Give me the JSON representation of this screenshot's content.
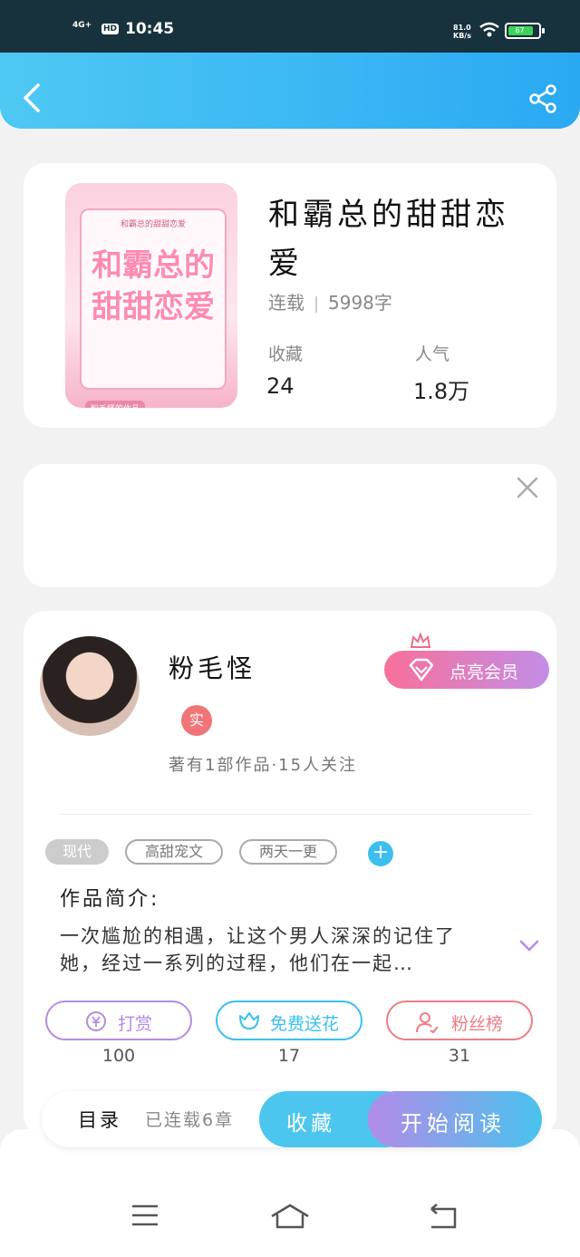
{
  "status_bar": {
    "network": "4G+",
    "hd": "HD",
    "time": "10:45",
    "speed_value": "81.0",
    "speed_unit": "KB/s",
    "battery": "67"
  },
  "book": {
    "cover_small_text": "和霸总的甜甜恋爱",
    "cover_big_text_1": "和霸总的",
    "cover_big_text_2": "甜甜恋爱",
    "cover_author_tag": "粉毛怪的作品",
    "title": "和霸总的甜甜恋爱",
    "status": "连载",
    "word_count": "5998字",
    "favorites_label": "收藏",
    "favorites_value": "24",
    "popularity_label": "人气",
    "popularity_value": "1.8万"
  },
  "author": {
    "name": "粉毛怪",
    "verified_badge": "实",
    "vip_button": "点亮会员",
    "stats": "著有1部作品·15人关注"
  },
  "tags": [
    "现代",
    "高甜宠文",
    "两天一更"
  ],
  "intro": {
    "label": "作品简介:",
    "text": "一次尴尬的相遇，让这个男人深深的记住了她，经过一系列的过程，他们在一起…"
  },
  "actions": [
    {
      "label": "打赏",
      "count": "100",
      "color": "#b58be0"
    },
    {
      "label": "免费送花",
      "count": "17",
      "color": "#3bbff0"
    },
    {
      "label": "粉丝榜",
      "count": "31",
      "color": "#ee7c84"
    }
  ],
  "bottom_bar": {
    "catalog": "目录",
    "chapters": "已连载6章",
    "favorite": "收藏",
    "start_reading": "开始阅读"
  },
  "colors": {
    "accent": "#2aa9f3",
    "vip_start": "#f8709a",
    "vip_end": "#c38de6"
  }
}
